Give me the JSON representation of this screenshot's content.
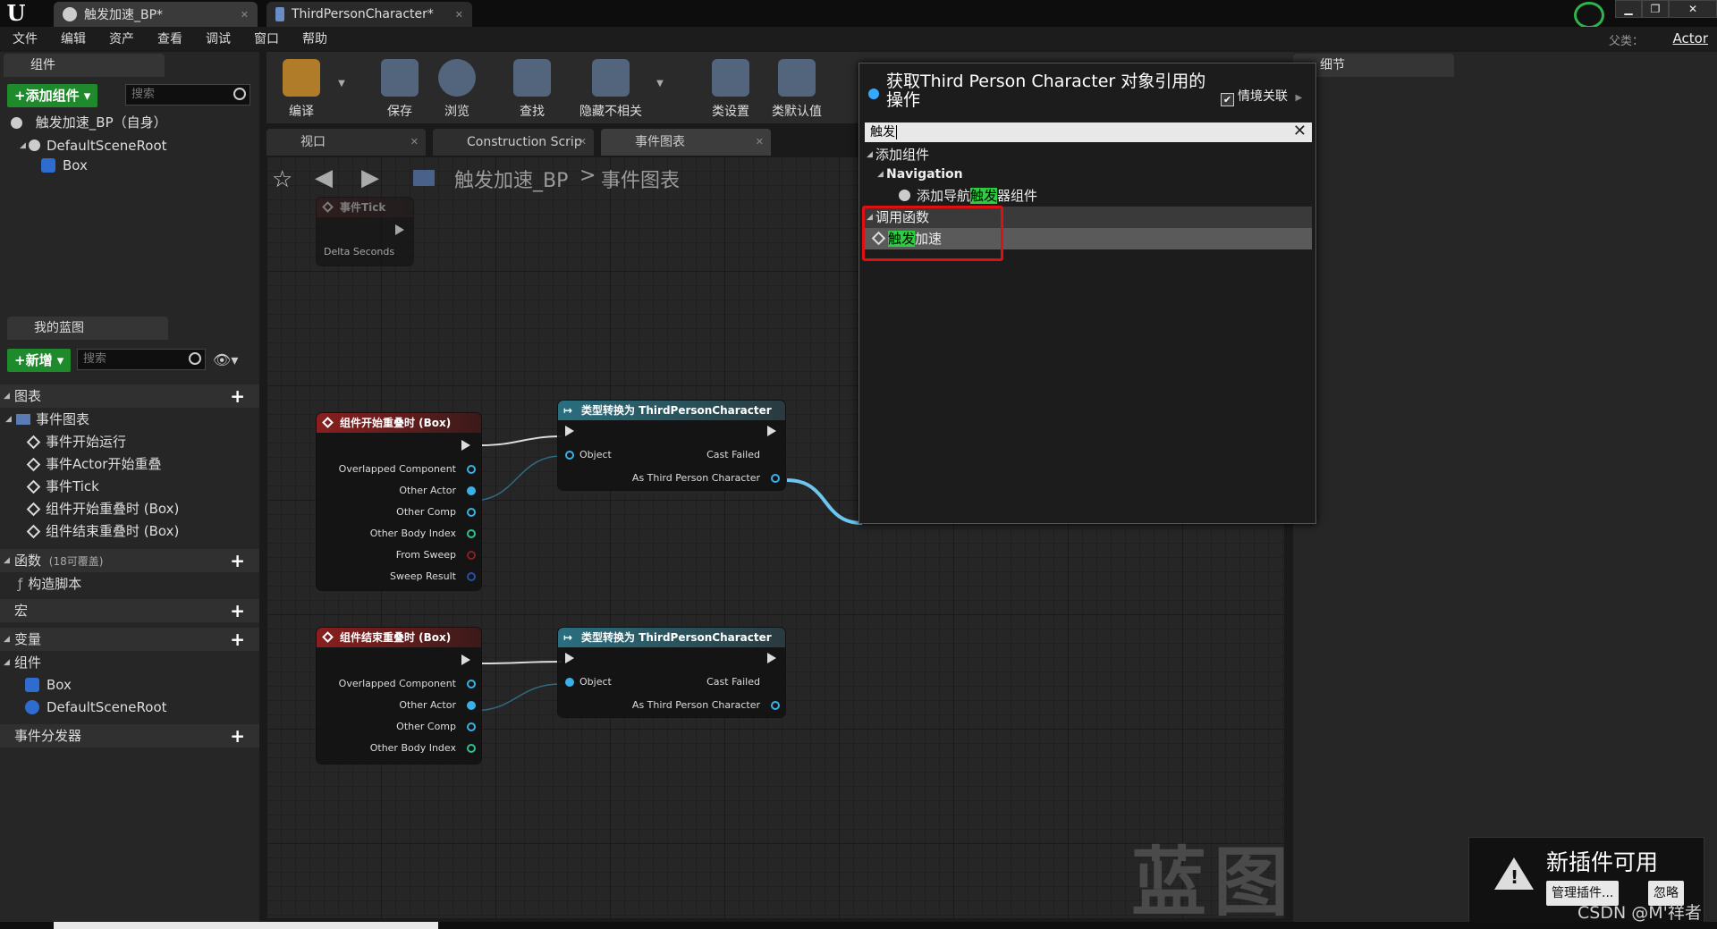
{
  "titlebar": {
    "tabs": [
      {
        "label": "触发加速_BP*"
      },
      {
        "label": "ThirdPersonCharacter*"
      }
    ]
  },
  "menu": [
    "文件",
    "编辑",
    "资产",
    "查看",
    "调试",
    "窗口",
    "帮助"
  ],
  "parent": {
    "label": "父类：",
    "value": "Actor"
  },
  "components_panel": {
    "tab": "组件",
    "add_button": "+添加组件 ▾",
    "search_placeholder": "搜索",
    "self_item": "触发加速_BP（自身）",
    "tree": [
      "DefaultSceneRoot",
      "Box"
    ]
  },
  "my_blueprint": {
    "tab": "我的蓝图",
    "new_button": "+新增 ▾",
    "search_placeholder": "搜索",
    "sections": {
      "graphs": "图表",
      "event_graph": "事件图表",
      "events": [
        "事件开始运行",
        "事件Actor开始重叠",
        "事件Tick",
        "组件开始重叠时 (Box)",
        "组件结束重叠时 (Box)"
      ],
      "functions": "函数",
      "functions_count": "(18可覆盖)",
      "construction": "构造脚本",
      "macros": "宏",
      "variables": "变量",
      "components": "组件",
      "component_items": [
        "Box",
        "DefaultSceneRoot"
      ],
      "dispatchers": "事件分发器"
    }
  },
  "toolbar": [
    "编译",
    "保存",
    "浏览",
    "查找",
    "隐藏不相关",
    "类设置",
    "类默认值"
  ],
  "graph_tabs": [
    "视口",
    "Construction Scrip",
    "事件图表"
  ],
  "breadcrumb": {
    "blueprint": "触发加速_BP",
    "separator": ">",
    "graph": "事件图表"
  },
  "watermark": "蓝图",
  "nodes": {
    "tick": {
      "title": "事件Tick",
      "pin": "Delta Seconds"
    },
    "begin_overlap": {
      "title": "组件开始重叠时 (Box)",
      "pins": [
        "Overlapped Component",
        "Other Actor",
        "Other Comp",
        "Other Body Index",
        "From Sweep",
        "Sweep Result"
      ]
    },
    "end_overlap": {
      "title": "组件结束重叠时 (Box)",
      "pins": [
        "Overlapped Component",
        "Other Actor",
        "Other Comp",
        "Other Body Index"
      ]
    },
    "cast1": {
      "title": "类型转换为 ThirdPersonCharacter",
      "object": "Object",
      "failed": "Cast Failed",
      "as": "As Third Person Character"
    },
    "cast2": {
      "title": "类型转换为 ThirdPersonCharacter",
      "object": "Object",
      "failed": "Cast Failed",
      "as": "As Third Person Character"
    }
  },
  "details": {
    "tab": "细节"
  },
  "popup": {
    "title": "获取Third Person Character 对象引用的操作",
    "context_label": "情境关联",
    "search_value": "触发",
    "cat_add_component": "添加组件",
    "cat_navigation": "Navigation",
    "nav_item_prefix": "添加导航",
    "nav_item_hl": "触发",
    "nav_item_suffix": "器组件",
    "cat_call_function": "调用函数",
    "fn_item_hl": "触发",
    "fn_item_suffix": "加速"
  },
  "notification": {
    "title": "新插件可用",
    "manage": "管理插件...",
    "ignore": "忽略"
  },
  "csdn": "CSDN @M'祥者"
}
